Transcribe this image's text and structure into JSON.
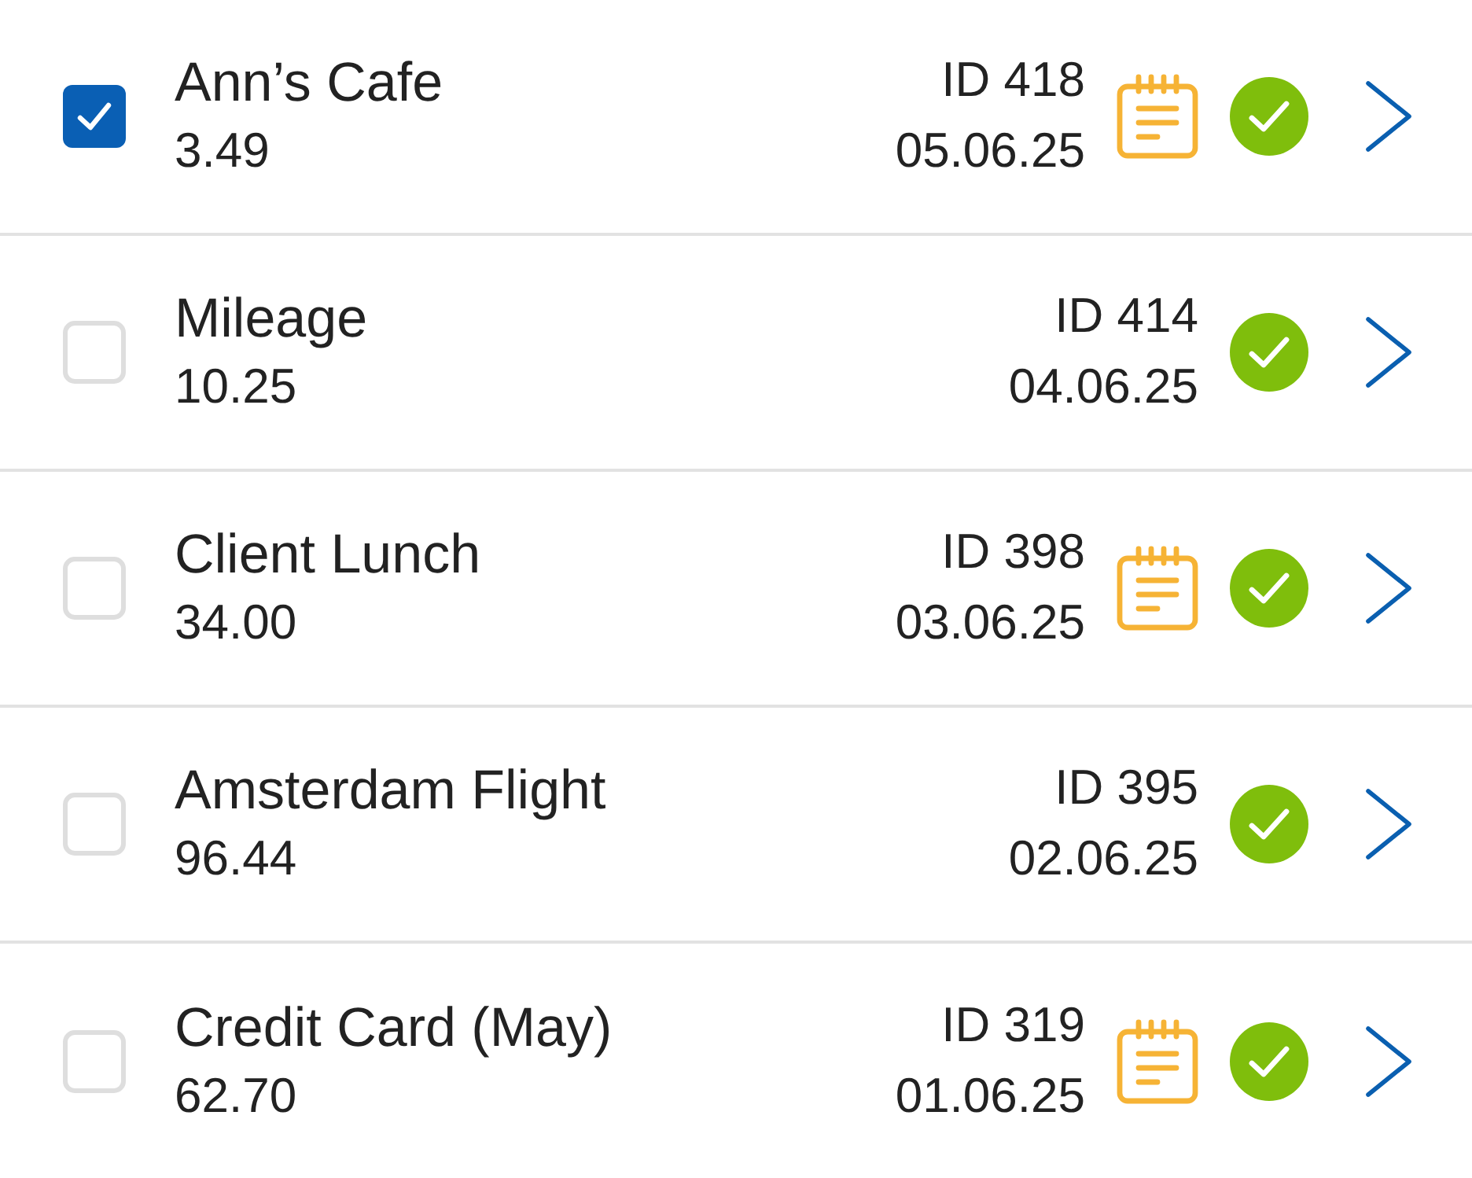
{
  "items": [
    {
      "title": "Ann’s Cafe",
      "amount": "3.49",
      "id": "ID 418",
      "date": "05.06.25",
      "checked": true,
      "has_note": true,
      "approved": true
    },
    {
      "title": "Mileage",
      "amount": "10.25",
      "id": "ID 414",
      "date": "04.06.25",
      "checked": false,
      "has_note": false,
      "approved": true
    },
    {
      "title": "Client Lunch",
      "amount": "34.00",
      "id": "ID 398",
      "date": "03.06.25",
      "checked": false,
      "has_note": true,
      "approved": true
    },
    {
      "title": "Amsterdam Flight",
      "amount": "96.44",
      "id": "ID 395",
      "date": "02.06.25",
      "checked": false,
      "has_note": false,
      "approved": true
    },
    {
      "title": "Credit Card (May)",
      "amount": "62.70",
      "id": "ID 319",
      "date": "01.06.25",
      "checked": false,
      "has_note": true,
      "approved": true
    }
  ]
}
